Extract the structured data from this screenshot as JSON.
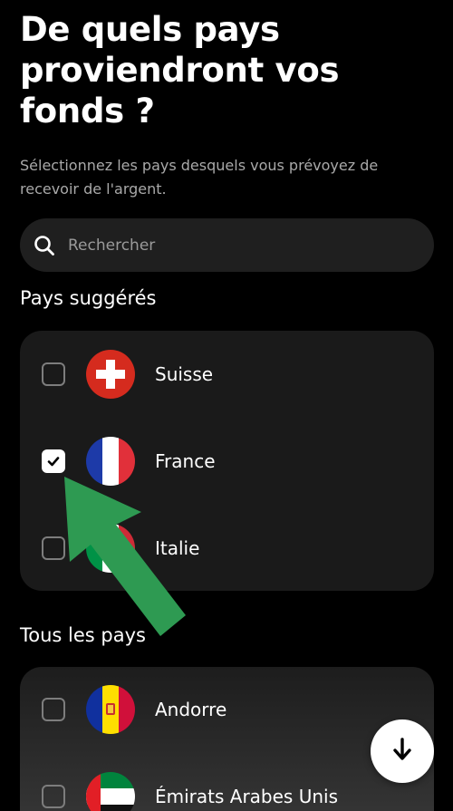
{
  "header": {
    "title_line1": "De quels pays",
    "title_line2": "proviendront vos",
    "title_line3": "fonds ?",
    "subtitle": "Sélectionnez les pays desquels vous prévoyez de recevoir de l'argent."
  },
  "search": {
    "placeholder": "Rechercher",
    "icon": "search-icon"
  },
  "suggested": {
    "title": "Pays suggérés",
    "items": [
      {
        "name": "Suisse",
        "checked": false,
        "flag": "switzerland-flag-icon"
      },
      {
        "name": "France",
        "checked": true,
        "flag": "france-flag-icon"
      },
      {
        "name": "Italie",
        "checked": false,
        "flag": "italy-flag-icon"
      }
    ]
  },
  "all": {
    "title": "Tous les pays",
    "items": [
      {
        "name": "Andorre",
        "checked": false,
        "flag": "andorra-flag-icon"
      },
      {
        "name": "Émirats Arabes Unis",
        "checked": false,
        "flag": "uae-flag-icon"
      }
    ]
  },
  "fab": {
    "icon": "arrow-down-icon"
  },
  "annotation": {
    "icon": "green-arrow-icon",
    "color": "#2e9a52"
  }
}
